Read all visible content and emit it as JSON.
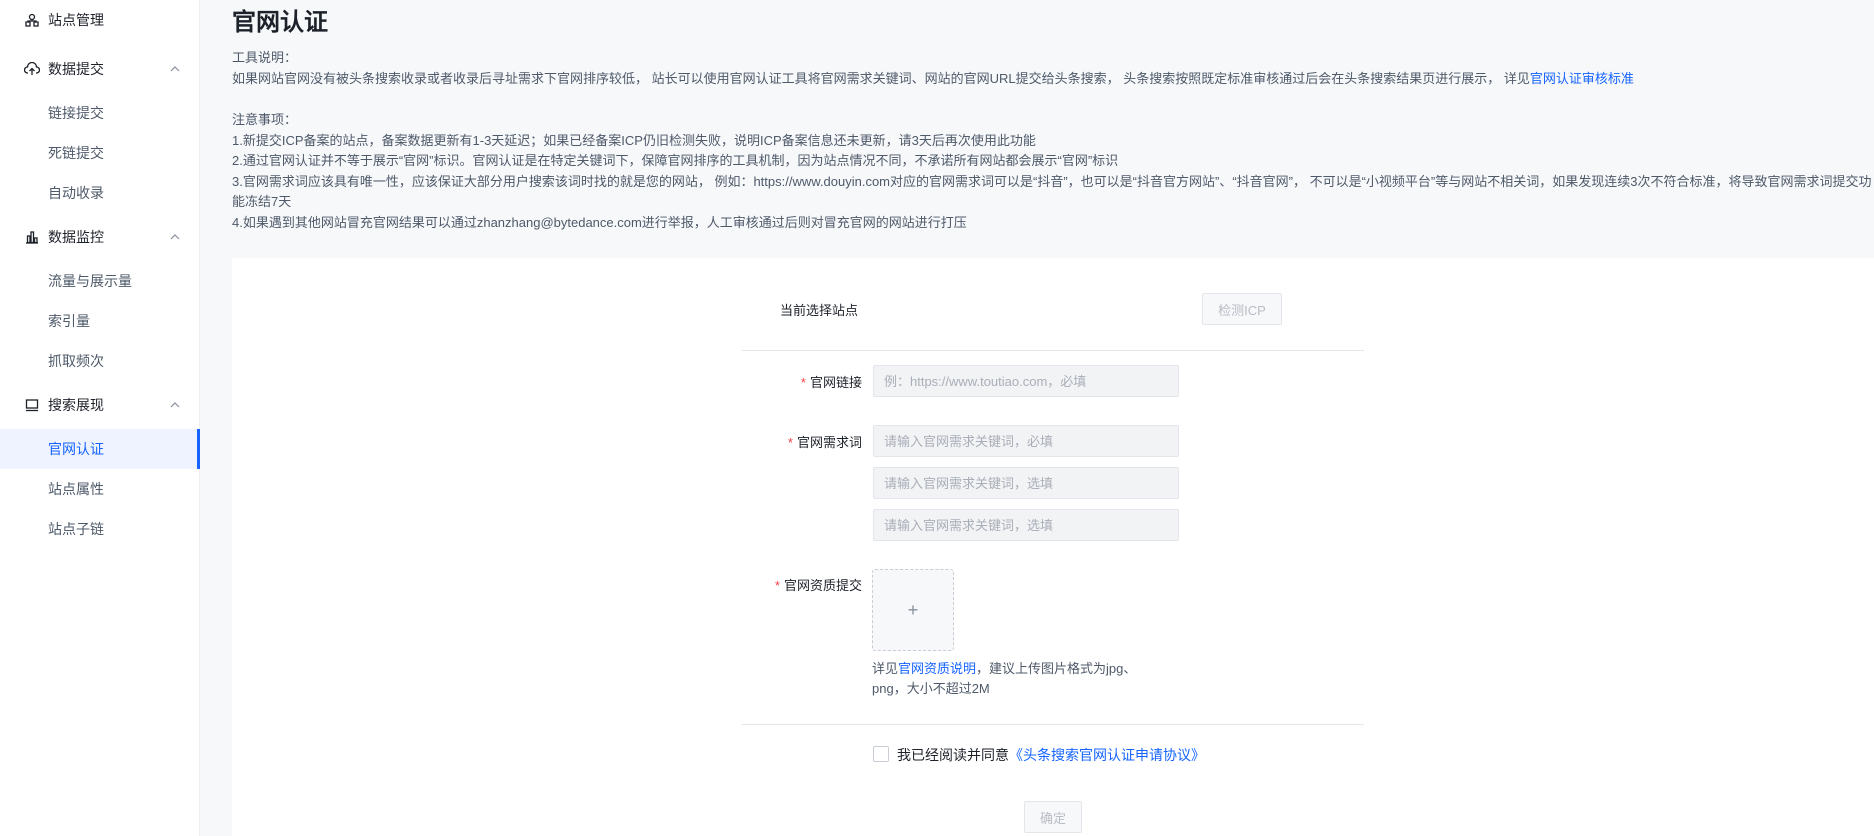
{
  "sidebar": {
    "site_management": "站点管理",
    "data_submit": {
      "label": "数据提交",
      "items": [
        "链接提交",
        "死链提交",
        "自动收录"
      ]
    },
    "data_monitor": {
      "label": "数据监控",
      "items": [
        "流量与展示量",
        "索引量",
        "抓取频次"
      ]
    },
    "search_display": {
      "label": "搜索展现",
      "items": [
        "官网认证",
        "站点属性",
        "站点子链"
      ]
    }
  },
  "page": {
    "title": "官网认证",
    "tool_desc_title": "工具说明：",
    "tool_desc_text": "如果网站官网没有被头条搜索收录或者收录后寻址需求下官网排序较低， 站长可以使用官网认证工具将官网需求关键词、网站的官网URL提交给头条搜索， 头条搜索按照既定标准审核通过后会在头条搜索结果页进行展示， 详见",
    "tool_desc_link": "官网认证审核标准",
    "notice_title": "注意事项：",
    "notices": [
      "1.新提交ICP备案的站点，备案数据更新有1-3天延迟；如果已经备案ICP仍旧检测失败，说明ICP备案信息还未更新，请3天后再次使用此功能",
      "2.通过官网认证并不等于展示“官网”标识。官网认证是在特定关键词下，保障官网排序的工具机制，因为站点情况不同，不承诺所有网站都会展示“官网”标识",
      "3.官网需求词应该具有唯一性，应该保证大部分用户搜索该词时找的就是您的网站， 例如：https://www.douyin.com对应的官网需求词可以是“抖音”，也可以是“抖音官方网站”、“抖音官网”， 不可以是“小视频平台”等与网站不相关词，如果发现连续3次不符合标准，将导致官网需求词提交功能冻结7天",
      "4.如果遇到其他网站冒充官网结果可以通过zhanzhang@bytedance.com进行举报，人工审核通过后则对冒充官网的网站进行打压"
    ]
  },
  "form": {
    "current_site_label": "当前选择站点",
    "check_icp_button": "检测ICP",
    "official_link_label": "官网链接",
    "official_link_placeholder": "例：https://www.toutiao.com，必填",
    "keyword_label": "官网需求词",
    "keyword_placeholder_required": "请输入官网需求关键词，必填",
    "keyword_placeholder_optional_1": "请输入官网需求关键词，选填",
    "keyword_placeholder_optional_2": "请输入官网需求关键词，选填",
    "qualification_label": "官网资质提交",
    "upload_plus": "+",
    "hint_prefix": "详见",
    "hint_link": "官网资质说明",
    "hint_suffix": "，建议上传图片格式为jpg、png，大小不超过2M",
    "agree_text": "我已经阅读并同意",
    "agree_link": "《头条搜索官网认证申请协议》",
    "confirm_button": "确定",
    "required_mark": "*"
  },
  "colors": {
    "accent": "#1664ff",
    "required": "#f53f3f",
    "active_bg": "#eef3ff"
  }
}
